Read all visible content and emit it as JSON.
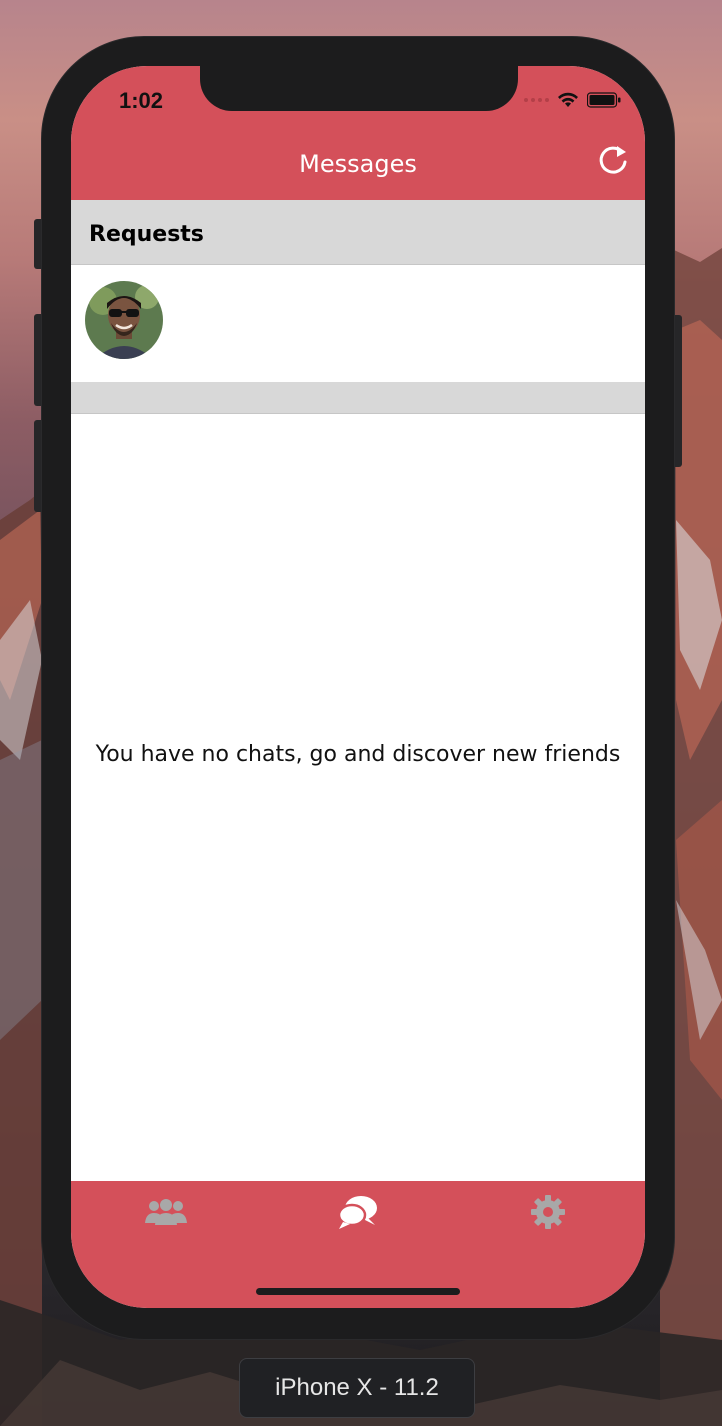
{
  "status_bar": {
    "time": "1:02",
    "icons": [
      "signal-dots-icon",
      "wifi-icon",
      "battery-icon"
    ]
  },
  "nav": {
    "title": "Messages",
    "refresh_icon": "refresh-icon"
  },
  "requests": {
    "section_title": "Requests",
    "avatars": [
      {
        "icon": "avatar"
      }
    ]
  },
  "chats": {
    "empty_message": "You have no chats, go and discover new friends"
  },
  "tabbar": {
    "tabs": [
      {
        "icon": "friends-icon",
        "active": false
      },
      {
        "icon": "chat-bubbles-icon",
        "active": true
      },
      {
        "icon": "gear-icon",
        "active": false
      }
    ]
  },
  "simulator": {
    "device_label": "iPhone X - 11.2"
  },
  "colors": {
    "accent": "#d4505a",
    "section_bg": "#d8d8d8",
    "inactive_icon": "#a8a8a8",
    "active_icon": "#ffffff"
  }
}
